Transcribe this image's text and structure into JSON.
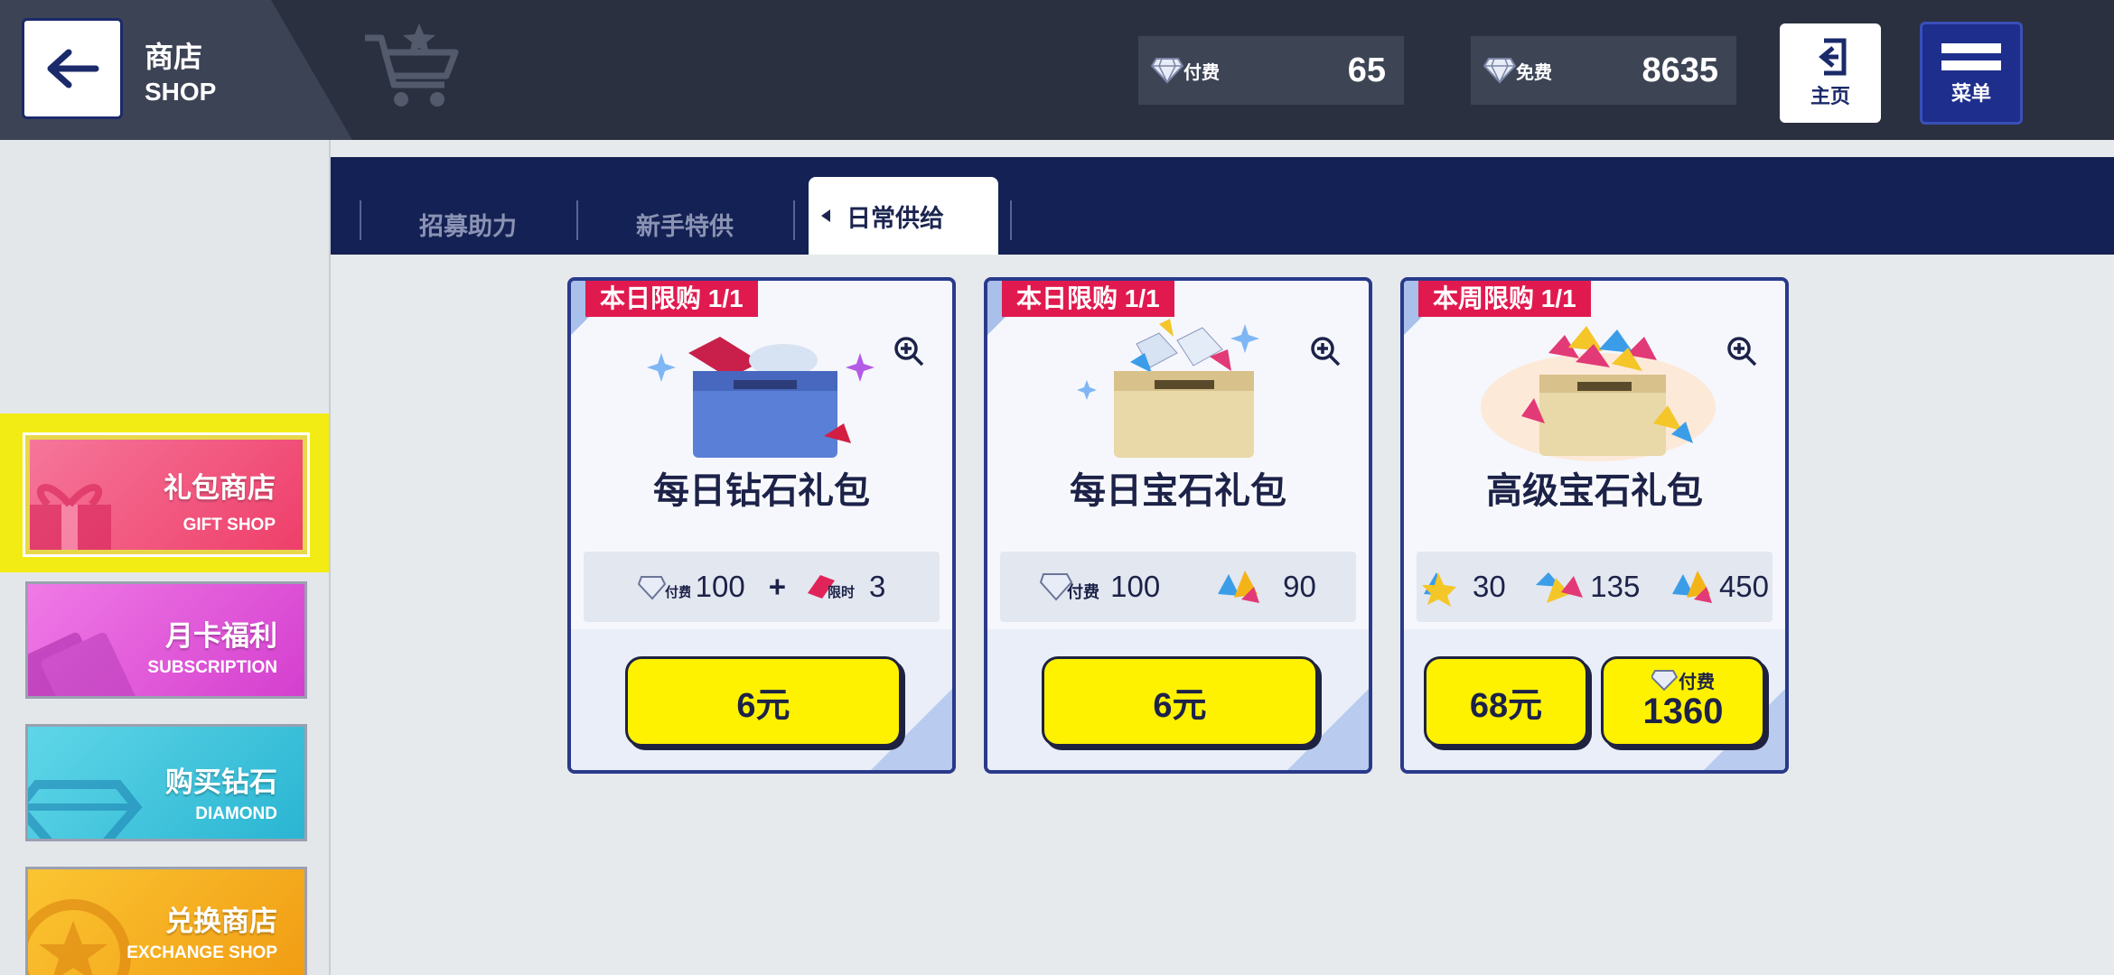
{
  "header": {
    "title_cn": "商店",
    "title_en": "SHOP",
    "currencies": [
      {
        "tag": "付费",
        "amount": "65",
        "icon": "diamond-icon"
      },
      {
        "tag": "免费",
        "amount": "8635",
        "icon": "diamond-icon"
      }
    ],
    "home_label": "主页",
    "menu_label": "菜单"
  },
  "sidebar": {
    "items": [
      {
        "cn": "礼包商店",
        "en": "GIFT SHOP",
        "color": "#f5577a",
        "selected": true
      },
      {
        "cn": "月卡福利",
        "en": "SUBSCRIPTION",
        "color": "#e85ad8",
        "selected": false
      },
      {
        "cn": "购买钻石",
        "en": "DIAMOND",
        "color": "#3cc6dd",
        "selected": false
      },
      {
        "cn": "兑换商店",
        "en": "EXCHANGE SHOP",
        "color": "#f6b21c",
        "selected": false
      }
    ]
  },
  "tabs": {
    "items": [
      "招募助力",
      "新手特供",
      "日常供给"
    ],
    "active": "日常供给"
  },
  "cards": [
    {
      "limit": "本日限购 1/1",
      "name": "每日钻石礼包",
      "contents": [
        {
          "icon": "paid-diamond-icon",
          "tag": "付费",
          "value": "100"
        },
        {
          "icon": "plus",
          "value": "+"
        },
        {
          "icon": "limited-ticket-icon",
          "tag": "限时",
          "value": "3"
        }
      ],
      "price": "6元"
    },
    {
      "limit": "本日限购 1/1",
      "name": "每日宝石礼包",
      "contents": [
        {
          "icon": "paid-diamond-icon",
          "tag": "付费",
          "value": "100"
        },
        {
          "icon": "gem-icon",
          "value": "90"
        }
      ],
      "price": "6元"
    },
    {
      "limit": "本周限购 1/1",
      "name": "高级宝石礼包",
      "contents": [
        {
          "icon": "gold-gem-icon",
          "value": "30"
        },
        {
          "icon": "multi-gem-icon",
          "value": "135"
        },
        {
          "icon": "gem-icon",
          "value": "450"
        }
      ],
      "price": "68元",
      "alt_price_tag": "付费",
      "alt_price": "1360"
    }
  ]
}
